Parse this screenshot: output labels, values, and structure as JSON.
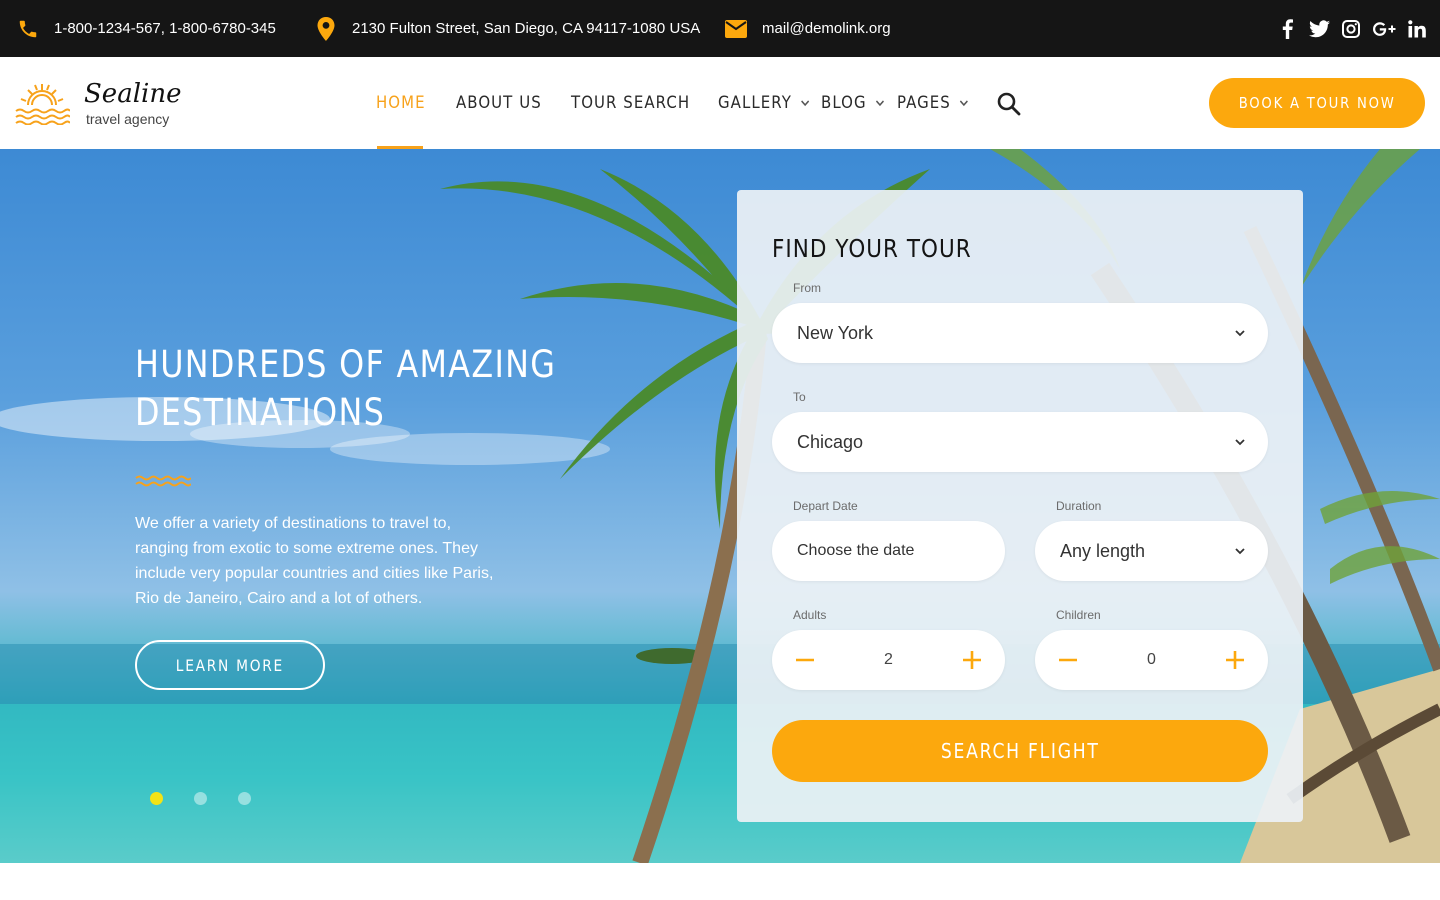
{
  "colors": {
    "accent": "#fca80d",
    "topbar": "#151515",
    "nav_active": "#f7a21b",
    "dot_active": "#f3e316"
  },
  "topbar": {
    "phones": "1-800-1234-567,  1-800-6780-345",
    "address": "2130 Fulton Street, San Diego, CA 94117-1080 USA",
    "email": "mail@demolink.org",
    "icons": [
      "phone-icon",
      "map-pin-icon",
      "mail-icon"
    ],
    "social": [
      "facebook-icon",
      "twitter-icon",
      "instagram-icon",
      "google-plus-icon",
      "linkedin-icon"
    ]
  },
  "brand": {
    "name": "Sealine",
    "tagline": "travel agency",
    "icon": "sun-waves-logo-icon"
  },
  "nav": {
    "items": [
      {
        "label": "HOME",
        "active": true
      },
      {
        "label": "ABOUT US"
      },
      {
        "label": "TOUR SEARCH"
      },
      {
        "label": "GALLERY",
        "dropdown": true
      },
      {
        "label": "BLOG",
        "dropdown": true
      },
      {
        "label": "PAGES",
        "dropdown": true
      }
    ],
    "search_icon": "search-icon",
    "cta": "BOOK A TOUR NOW"
  },
  "hero": {
    "title_line1": "HUNDREDS OF AMAZING",
    "title_line2": "DESTINATIONS",
    "text": "We offer a variety of destinations to travel to, ranging from exotic to some extreme ones. They include very popular countries and cities like Paris, Rio de Janeiro, Cairo and a lot of others.",
    "button": "LEARN MORE",
    "slides_total": 3,
    "slide_active": 1
  },
  "search_form": {
    "title": "FIND YOUR TOUR",
    "from_label": "From",
    "from_value": "New York",
    "to_label": "To",
    "to_value": "Chicago",
    "depart_label": "Depart Date",
    "depart_placeholder": "Choose the date",
    "duration_label": "Duration",
    "duration_value": "Any length",
    "adults_label": "Adults",
    "adults_value": "2",
    "children_label": "Children",
    "children_value": "0",
    "submit": "SEARCH FLIGHT"
  }
}
